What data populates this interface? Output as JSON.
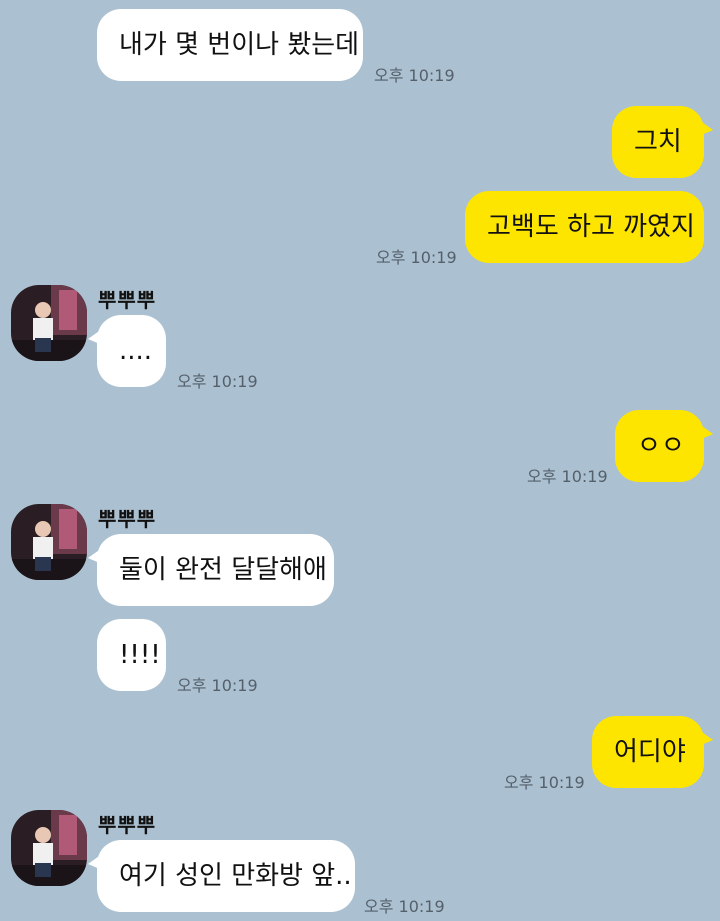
{
  "sender_name": "뿌뿌뿌",
  "messages": {
    "m1": {
      "text": "내가 몇 번이나 봤는데",
      "time": "오후 10:19"
    },
    "m2": {
      "text": "그치"
    },
    "m3": {
      "text": "고백도 하고 까였지",
      "time": "오후 10:19"
    },
    "m4": {
      "text": "....",
      "time": "오후 10:19"
    },
    "m5": {
      "text": "ㅇㅇ",
      "time": "오후 10:19"
    },
    "m6": {
      "text": "둘이 완전 달달해애"
    },
    "m7": {
      "text": "!!!!",
      "time": "오후 10:19"
    },
    "m8": {
      "text": "어디야",
      "time": "오후 10:19"
    },
    "m9": {
      "text": "여기 성인 만화방 앞..",
      "time": "오후 10:19"
    }
  },
  "colors": {
    "background": "#abc1d1",
    "incoming_bubble": "#ffffff",
    "outgoing_bubble": "#fee500"
  },
  "icons": {
    "avatar": "profile-photo"
  }
}
